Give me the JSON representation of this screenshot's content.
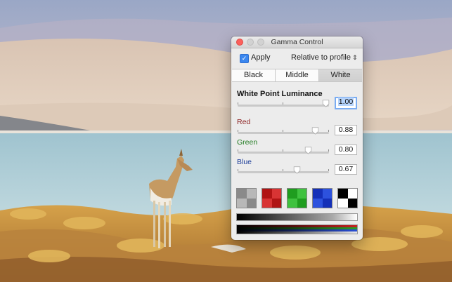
{
  "window": {
    "title": "Gamma Control"
  },
  "apply": {
    "label": "Apply",
    "checked": true
  },
  "mode_popup": {
    "selected": "Relative to profile"
  },
  "tabs": [
    {
      "label": "Black",
      "active": false
    },
    {
      "label": "Middle",
      "active": false
    },
    {
      "label": "White",
      "active": true
    }
  ],
  "white_point": {
    "heading": "White Point Luminance",
    "value": "1.00",
    "level": 0.96
  },
  "channels": [
    {
      "label": "Red",
      "value": "0.88",
      "level": 0.85,
      "color": "#8b1e1e"
    },
    {
      "label": "Green",
      "value": "0.80",
      "level": 0.77,
      "color": "#1f7a1f"
    },
    {
      "label": "Blue",
      "value": "0.67",
      "level": 0.65,
      "color": "#1f3f9a"
    }
  ],
  "colors": {
    "accent": "#3b87ef",
    "close": "#fc605c"
  }
}
